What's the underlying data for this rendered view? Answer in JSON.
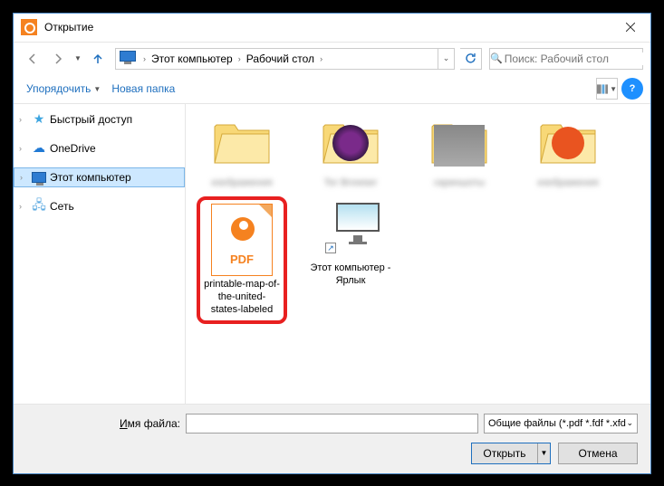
{
  "window": {
    "title": "Открытие"
  },
  "nav": {
    "breadcrumb": {
      "root": "Этот компьютер",
      "folder": "Рабочий стол"
    },
    "search_placeholder": "Поиск: Рабочий стол"
  },
  "toolbar": {
    "organize": "Упорядочить",
    "new_folder": "Новая папка"
  },
  "sidebar": {
    "quick_access": "Быстрый доступ",
    "onedrive": "OneDrive",
    "this_pc": "Этот компьютер",
    "network": "Сеть"
  },
  "files": {
    "item1": "изображения",
    "item2": "Tor Browser",
    "item3": "скриншоты",
    "item4": "изображения",
    "pdf_name": "printable-map-of-the-united-states-labeled",
    "pc_shortcut": "Этот компьютер - Ярлык",
    "pdf_badge": "PDF"
  },
  "footer": {
    "filename_label_prefix": "Имя файла:",
    "filter": "Общие файлы (*.pdf *.fdf *.xfd",
    "open": "Открыть",
    "cancel": "Отмена"
  }
}
